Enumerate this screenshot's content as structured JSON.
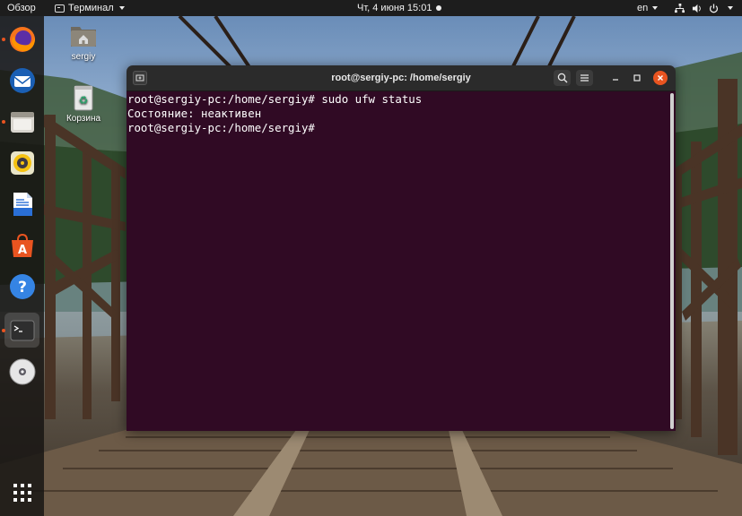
{
  "topbar": {
    "activities_label": "Обзор",
    "app_menu_label": "Терминал",
    "clock": "Чт, 4 июня  15:01",
    "input_language": "en",
    "system_icons": [
      "network-icon",
      "volume-icon",
      "power-icon"
    ]
  },
  "dock": {
    "items": [
      {
        "name": "firefox",
        "icon": "firefox-icon",
        "running": true
      },
      {
        "name": "thunderbird",
        "icon": "thunderbird-icon",
        "running": false
      },
      {
        "name": "files",
        "icon": "files-icon",
        "running": true
      },
      {
        "name": "rhythmbox",
        "icon": "rhythmbox-icon",
        "running": false
      },
      {
        "name": "writer",
        "icon": "writer-icon",
        "running": false
      },
      {
        "name": "software",
        "icon": "software-store-icon",
        "running": false
      },
      {
        "name": "help",
        "icon": "help-icon",
        "running": false
      },
      {
        "name": "terminal",
        "icon": "terminal-icon",
        "running": true,
        "active": true
      },
      {
        "name": "dvd",
        "icon": "dvd-icon",
        "running": false
      },
      {
        "name": "show-apps",
        "icon": "app-grid-icon",
        "running": false
      }
    ]
  },
  "desktop": {
    "home_icon_label": "sergiy",
    "trash_icon_label": "Корзина"
  },
  "terminal": {
    "title": "root@sergiy-pc: /home/sergiy",
    "lines": [
      "root@sergiy-pc:/home/sergiy# sudo ufw status",
      "Состояние: неактивен",
      "root@sergiy-pc:/home/sergiy#"
    ],
    "colors": {
      "background": "#300a24",
      "text": "#ffffff",
      "close": "#e95420"
    }
  }
}
